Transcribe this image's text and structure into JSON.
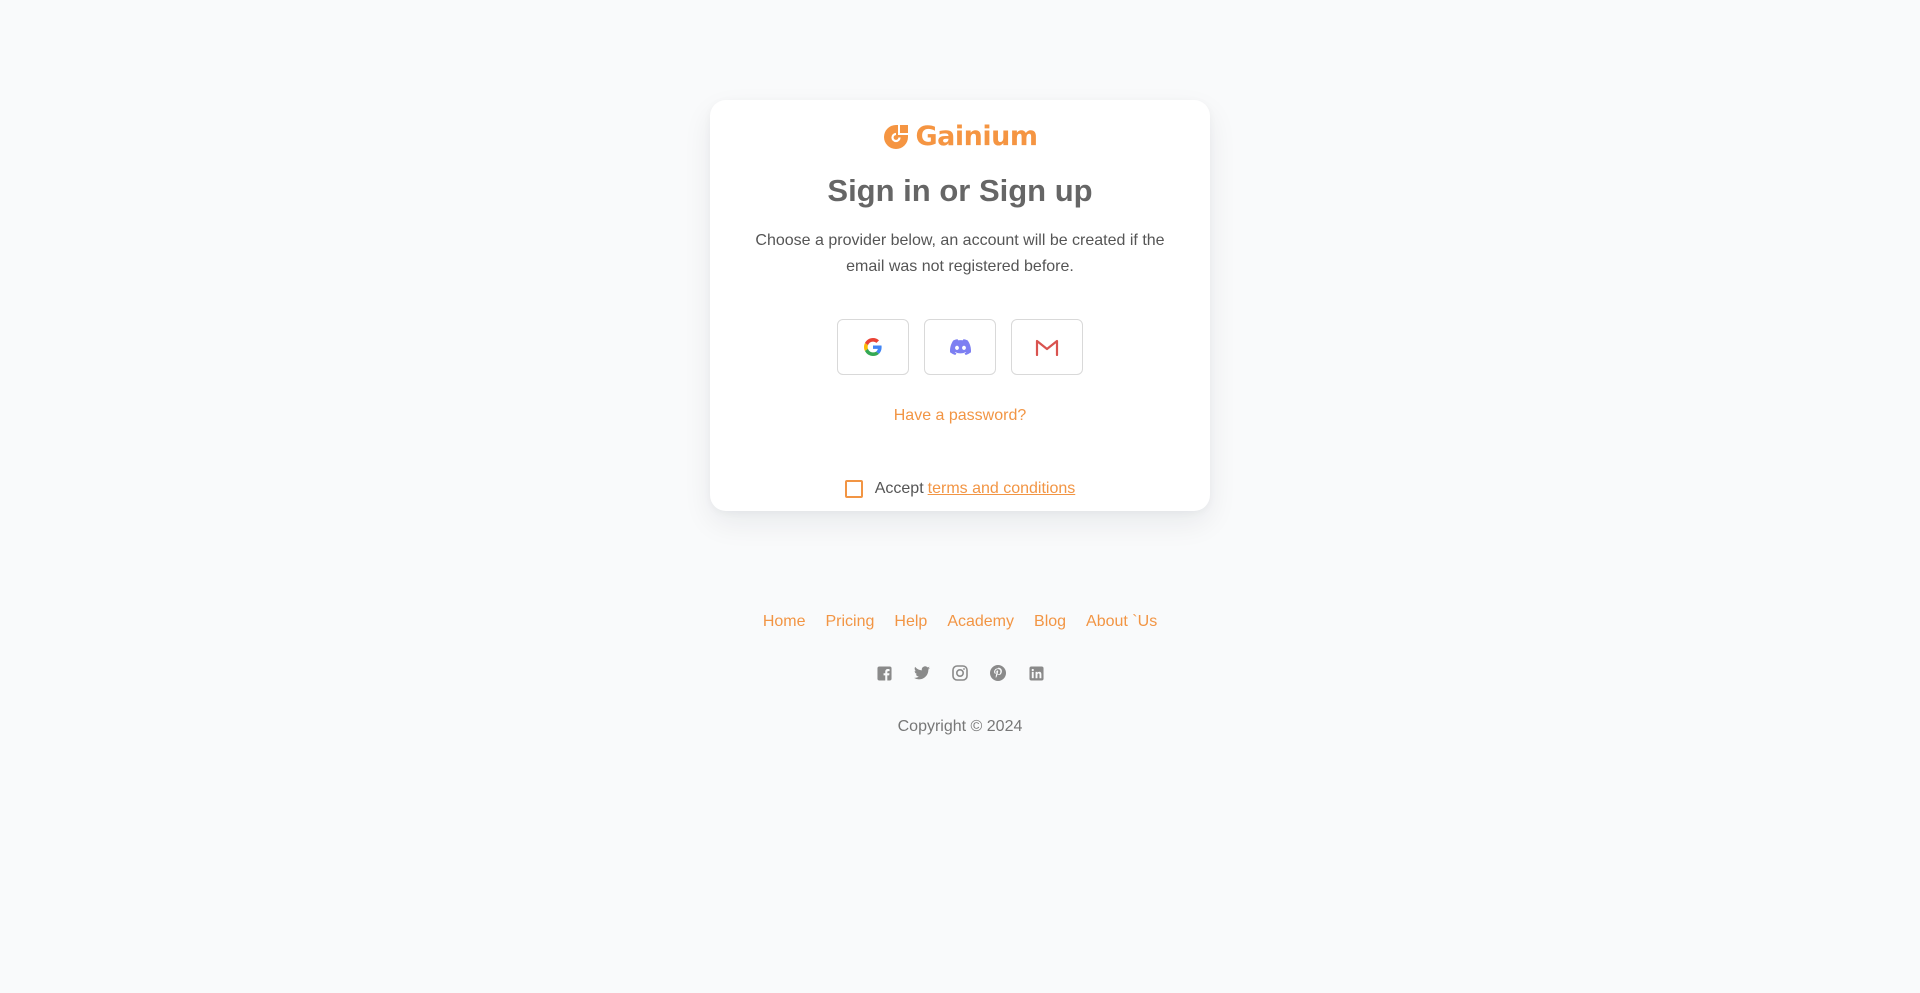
{
  "brand": {
    "name": "Gainium",
    "color": "#f59542"
  },
  "auth": {
    "title": "Sign in or Sign up",
    "subtitle": "Choose a provider below, an account will be created if the email was not registered before.",
    "providers": [
      {
        "name": "google",
        "icon": "google-icon"
      },
      {
        "name": "discord",
        "icon": "discord-icon",
        "color": "#7d7ff2"
      },
      {
        "name": "gmail",
        "icon": "gmail-icon",
        "color": "#d9534f"
      }
    ],
    "password_link": "Have a password?",
    "terms": {
      "prefix": "Accept",
      "link": "terms and conditions",
      "checked": false
    }
  },
  "footer": {
    "nav": [
      "Home",
      "Pricing",
      "Help",
      "Academy",
      "Blog",
      "About `Us"
    ],
    "socials": [
      "facebook-icon",
      "twitter-icon",
      "instagram-icon",
      "pinterest-icon",
      "linkedin-icon"
    ],
    "copyright": "Copyright © 2024"
  },
  "colors": {
    "accent": "#f29544",
    "background": "#f9fafb",
    "muted_icon": "#8a8a8a"
  }
}
